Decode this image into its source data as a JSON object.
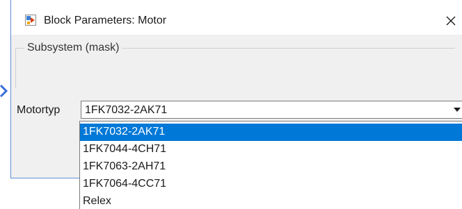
{
  "window": {
    "title": "Block Parameters: Motor",
    "icon": "simulink-block-icon",
    "close_icon": "close-icon"
  },
  "group": {
    "title": "Subsystem (mask)"
  },
  "parameter": {
    "label": "Motortyp",
    "selected_value": "1FK7032-2AK71",
    "arrow_icon": "chevron-down-icon"
  },
  "dropdown": {
    "options": [
      "1FK7032-2AK71",
      "1FK7044-4CH71",
      "1FK7063-2AH71",
      "1FK7064-4CC71",
      "Relex"
    ],
    "highlighted_index": 0
  },
  "colors": {
    "highlight": "#0078d7",
    "window_border": "#5b8fd6",
    "dialog_background": "#f0f0f0"
  }
}
